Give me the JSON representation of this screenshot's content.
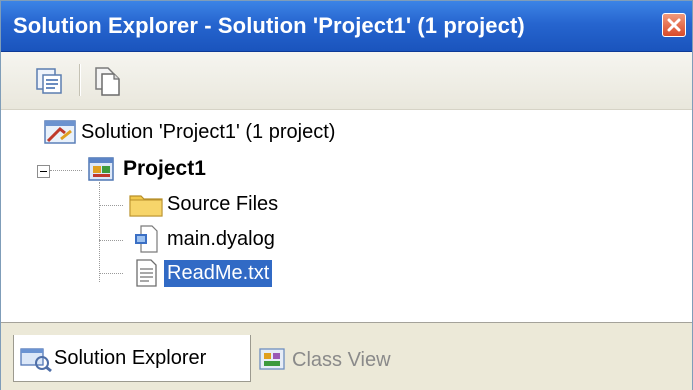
{
  "window": {
    "title": "Solution Explorer - Solution 'Project1' (1 project)",
    "close_icon": "close-icon",
    "accent": "#2665cf"
  },
  "toolbar": {
    "buttons": [
      {
        "icon": "properties-icon"
      },
      {
        "icon": "show-all-files-icon"
      }
    ]
  },
  "tree": {
    "solution": {
      "label": "Solution 'Project1' (1 project)",
      "icon": "solution-icon"
    },
    "project": {
      "label": "Project1",
      "icon": "project-icon",
      "expanded": true
    },
    "children": [
      {
        "label": "Source Files",
        "icon": "folder-icon"
      },
      {
        "label": "main.dyalog",
        "icon": "dyalog-file-icon"
      },
      {
        "label": "ReadMe.txt",
        "icon": "text-file-icon",
        "selected": true
      }
    ],
    "selection_color": "#316ac5"
  },
  "tabs": [
    {
      "label": "Solution Explorer",
      "icon": "solution-explorer-icon",
      "active": true
    },
    {
      "label": "Class View",
      "icon": "class-view-icon",
      "active": false
    }
  ]
}
